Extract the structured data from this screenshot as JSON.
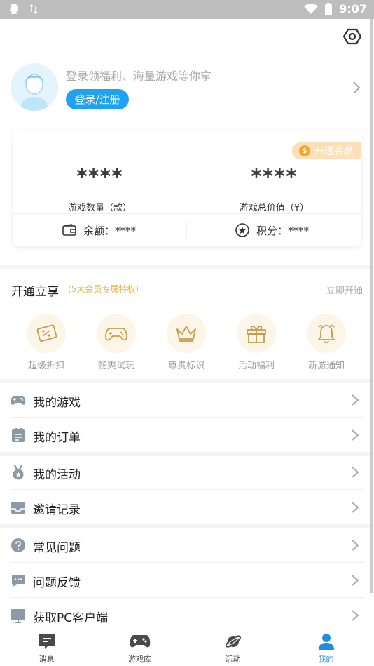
{
  "status_bar": {
    "time": "9:07"
  },
  "profile": {
    "login_tip": "登录领福利、海量游戏等你拿",
    "login_button": "登录/注册"
  },
  "stats": {
    "vip_badge": "开通会员",
    "game_count_value": "****",
    "game_count_label": "游戏数量（款）",
    "game_value_value": "****",
    "game_value_label": "游戏总价值（¥）",
    "balance_label": "余额：****",
    "points_label": "积分：****"
  },
  "vip": {
    "title": "开通立享",
    "subtitle": "(5大会员专属特权)",
    "open_link": "立即开通",
    "perks": [
      {
        "label": "超级折扣",
        "icon": "discount-ticket-icon"
      },
      {
        "label": "畅爽试玩",
        "icon": "gamepad-icon"
      },
      {
        "label": "尊贵标识",
        "icon": "crown-icon"
      },
      {
        "label": "活动福利",
        "icon": "gift-icon"
      },
      {
        "label": "新游通知",
        "icon": "bell-icon"
      }
    ]
  },
  "menu": {
    "my_games": "我的游戏",
    "my_orders": "我的订单",
    "my_activities": "我的活动",
    "invite_records": "邀请记录",
    "faq": "常见问题",
    "feedback": "问题反馈",
    "get_pc_client": "获取PC客户端"
  },
  "tabbar": {
    "tabs": [
      {
        "label": "消息",
        "icon": "message-icon"
      },
      {
        "label": "游戏库",
        "icon": "game-library-icon"
      },
      {
        "label": "活动",
        "icon": "planet-icon"
      },
      {
        "label": "我的",
        "icon": "user-icon"
      }
    ]
  },
  "colors": {
    "accent": "#1fa3f0",
    "vip_gold": "#f0b13a",
    "tab_active": "#1f8ee0"
  }
}
